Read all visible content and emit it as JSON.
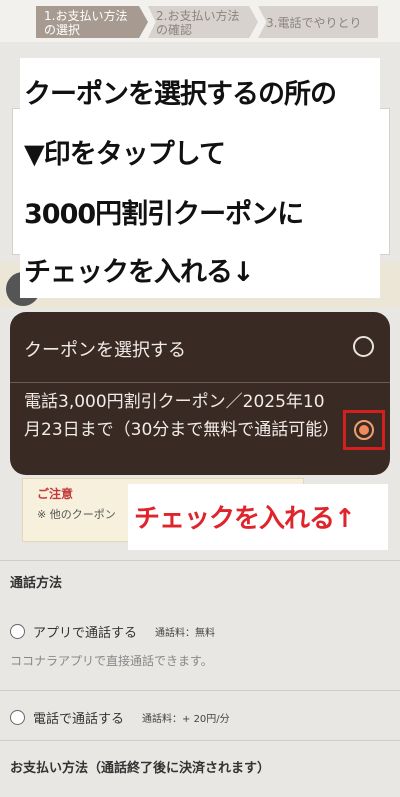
{
  "steps": [
    {
      "line1": "1.お支払い方法",
      "line2": "の選択"
    },
    {
      "line1": "2.お支払い方法",
      "line2": "の確認"
    },
    {
      "line1": "3.電話でやりとり",
      "line2": ""
    }
  ],
  "annotation_top": {
    "lines": [
      "クーポンを選択するの所の",
      "▼印をタップして",
      "3000円割引クーポンに",
      "チェックを入れる↓"
    ]
  },
  "coupon_panel": {
    "title": "クーポンを選択する",
    "option_text": "電話3,000円割引クーポン／2025年10月23日まで（30分まで無料で通話可能）",
    "option_selected": true,
    "accent_color": "#f08a5a",
    "highlight_color": "#d41f1f"
  },
  "notice": {
    "title": "ご注意",
    "body": "※ 他のクーポン"
  },
  "annotation_bottom": {
    "text": "チェックを入れる↑"
  },
  "call_method": {
    "label": "通話方法",
    "options": [
      {
        "label": "アプリで通話する",
        "fee": "通話料：無料",
        "sub": "ココナラアプリで直接通話できます。"
      },
      {
        "label": "電話で通話する",
        "fee": "通話料：+ 20円/分",
        "sub": ""
      }
    ]
  },
  "payment": {
    "label": "お支払い方法（通話終了後に決済されます）"
  }
}
